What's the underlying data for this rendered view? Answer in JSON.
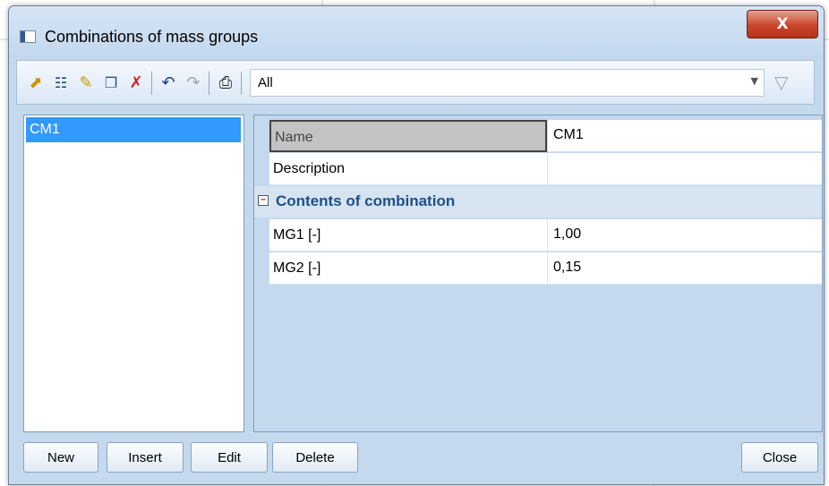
{
  "window": {
    "title": "Combinations of mass groups",
    "close_glyph": "X"
  },
  "toolbar": {
    "icons": [
      "new-icon",
      "insert-icon",
      "edit-icon",
      "copy-icon",
      "delete-icon",
      "undo-icon",
      "redo-icon",
      "print-icon"
    ],
    "filter_value": "All"
  },
  "list": {
    "items": [
      {
        "label": "CM1",
        "selected": true
      }
    ]
  },
  "properties": {
    "name": {
      "label": "Name",
      "value": "CM1"
    },
    "description": {
      "label": "Description",
      "value": ""
    },
    "group": {
      "label": "Contents of combination",
      "collapse_glyph": "−"
    },
    "mg1": {
      "label": "MG1 [-]",
      "value": "1,00"
    },
    "mg2": {
      "label": "MG2 [-]",
      "value": "0,15"
    }
  },
  "buttons": {
    "new": "New",
    "insert": "Insert",
    "edit": "Edit",
    "delete": "Delete",
    "close": "Close"
  },
  "colors": {
    "selection": "#3399ff",
    "frame": "#c4d9ee",
    "group_text": "#1f4f8a"
  }
}
